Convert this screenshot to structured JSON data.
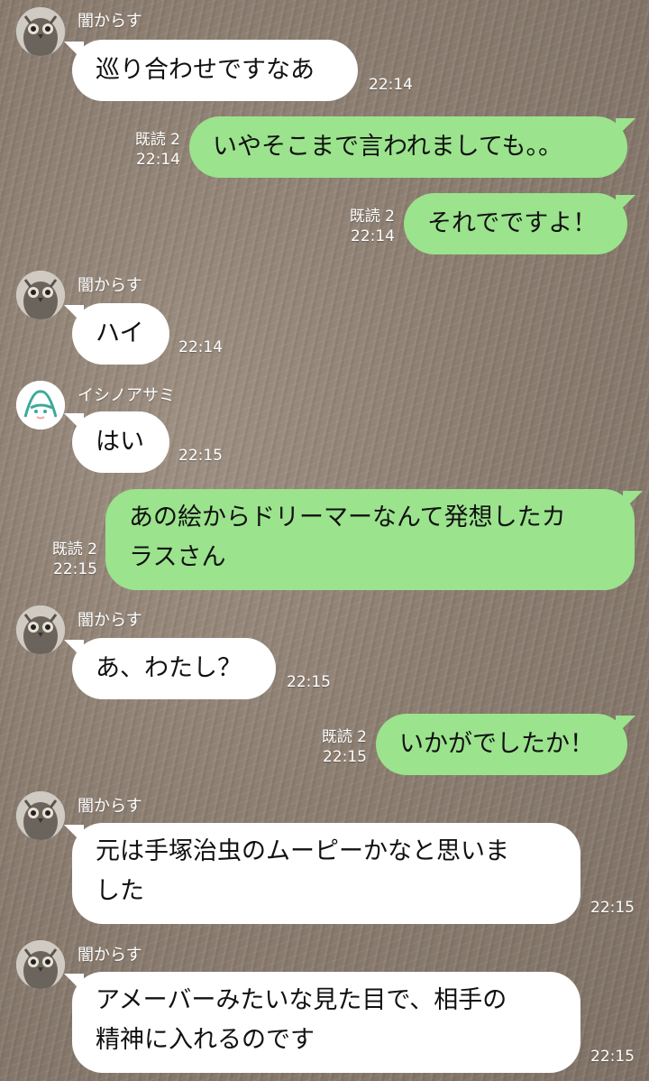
{
  "contacts": {
    "karasu": {
      "name": "闇からす",
      "avatar_icon": "owl-avatar-icon"
    },
    "ishinoasami": {
      "name": "イシノアサミ",
      "avatar_icon": "smiley-a-avatar-icon"
    }
  },
  "colors": {
    "incoming_bubble": "#ffffff",
    "outgoing_bubble": "#9be38d",
    "meta_text": "#ffffff"
  },
  "messages": [
    {
      "sender": "闇からす",
      "text": "巡り合わせですなあ",
      "time": "22:14"
    },
    {
      "read": "既読 2",
      "text": "いやそこまで言われましても。。",
      "time": "22:14"
    },
    {
      "read": "既読 2",
      "text": "それでですよ！",
      "time": "22:14"
    },
    {
      "sender": "闇からす",
      "text": "ハイ",
      "time": "22:14"
    },
    {
      "sender": "イシノアサミ",
      "text": "はい",
      "time": "22:15"
    },
    {
      "read": "既読 2",
      "line1": "あの絵からドリーマーなんて発想したカ",
      "line2": "ラスさん",
      "time": "22:15"
    },
    {
      "sender": "闇からす",
      "text": "あ、わたし？",
      "time": "22:15"
    },
    {
      "read": "既読 2",
      "text": "いかがでしたか！",
      "time": "22:15"
    },
    {
      "sender": "闇からす",
      "line1": "元は手塚治虫のムーピーかなと思いま",
      "line2": "した",
      "time": "22:15"
    },
    {
      "sender": "闇からす",
      "line1": "アメーバーみたいな見た目で、相手の",
      "line2": "精神に入れるのです",
      "time": "22:15"
    }
  ]
}
